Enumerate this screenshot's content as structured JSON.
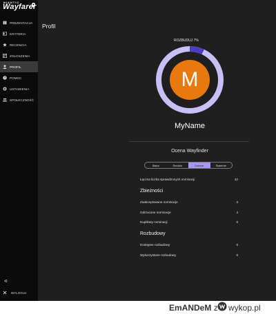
{
  "brand": {
    "small": "NIANTIC",
    "name": "Wayfarer"
  },
  "sidebar": {
    "items": [
      {
        "label": "PREZENTACJA",
        "icon": "book-icon"
      },
      {
        "label": "KRYTERIA",
        "icon": "id-card-icon"
      },
      {
        "label": "RECENZJA",
        "icon": "star-icon"
      },
      {
        "label": "ZGŁOSZENIA",
        "icon": "inbox-icon"
      },
      {
        "label": "PROFIL",
        "icon": "person-icon",
        "active": true
      },
      {
        "label": "POMOC",
        "icon": "help-icon"
      },
      {
        "label": "USTAWIENIA",
        "icon": "gear-icon"
      },
      {
        "label": "SPOŁECZNOŚĆ",
        "icon": "people-icon"
      }
    ],
    "logout_label": "WYLOGUJ"
  },
  "page": {
    "title": "Profil"
  },
  "profile": {
    "upgrade_progress_label": "ROZBUDUJ 7%",
    "upgrade_progress": 0.07,
    "avatar_letter": "M",
    "username": "MyName"
  },
  "rating": {
    "title": "Ocena Wayfinder",
    "levels": [
      "Słabo",
      "Średnio",
      "Dobrze",
      "Świetnie"
    ],
    "selected": "Dobrze",
    "total_label": "Łączna liczba sprawdzonych nominacji",
    "total_value": "42"
  },
  "agreements": {
    "title": "Zbieżności",
    "rows": [
      {
        "label": "Zaakceptowane nominacje",
        "value": "3"
      },
      {
        "label": "Odrzucone nominacje",
        "value": "4"
      },
      {
        "label": "Duplikaty nominacji",
        "value": "0"
      }
    ]
  },
  "upgrades": {
    "title": "Rozbudowy",
    "rows": [
      {
        "label": "Dostępne rozbudowy",
        "value": "0"
      },
      {
        "label": "Wykorzystane rozbudowy",
        "value": "0"
      }
    ]
  },
  "footer": {
    "author": "EmANDeM",
    "separator": "z",
    "site": "wykop.pl"
  },
  "colors": {
    "accent": "#a996f2",
    "progress": "#4a3fbf",
    "ring": "#c9bff5",
    "avatar": "#e9780e"
  }
}
